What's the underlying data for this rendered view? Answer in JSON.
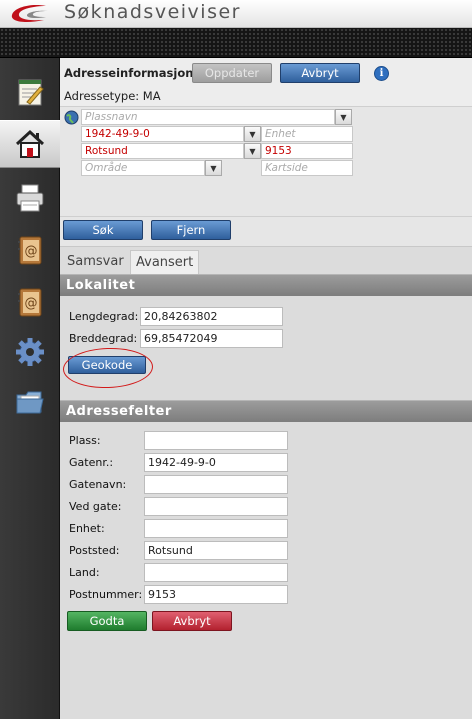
{
  "app": {
    "title": "Søknadsveiviser"
  },
  "sidebar": {
    "items": [
      {
        "icon": "notepad-icon"
      },
      {
        "icon": "house-icon",
        "active": true
      },
      {
        "icon": "printer-icon"
      },
      {
        "icon": "address-book-icon"
      },
      {
        "icon": "address-book-icon"
      },
      {
        "icon": "gear-icon"
      },
      {
        "icon": "folder-icon"
      }
    ]
  },
  "header": {
    "label": "Adresseinformasjon:",
    "update_label": "Oppdater",
    "cancel_label": "Avbryt",
    "address_type": "Adressetype: MA"
  },
  "address": {
    "plassnavn_placeholder": "Plassnavn",
    "gatenr_value": "1942-49-9-0",
    "enhet_placeholder": "Enhet",
    "poststed_value": "Rotsund",
    "postnummer_value": "9153",
    "omrade_placeholder": "Område",
    "kartside_placeholder": "Kartside"
  },
  "search": {
    "search_label": "Søk",
    "remove_label": "Fjern"
  },
  "tabs": [
    {
      "label": "Samsvar"
    },
    {
      "label": "Avansert",
      "active": true
    }
  ],
  "lokalitet": {
    "title": "Lokalitet",
    "lengdegrad_label": "Lengdegrad:",
    "lengdegrad_value": "20,84263802",
    "breddegrad_label": "Breddegrad:",
    "breddegrad_value": "69,85472049",
    "geokode_label": "Geokode"
  },
  "adressefelter": {
    "title": "Adressefelter",
    "fields": [
      {
        "label": "Plass:",
        "value": ""
      },
      {
        "label": "Gatenr.:",
        "value": "1942-49-9-0"
      },
      {
        "label": "Gatenavn:",
        "value": ""
      },
      {
        "label": "Ved gate:",
        "value": ""
      },
      {
        "label": "Enhet:",
        "value": ""
      },
      {
        "label": "Poststed:",
        "value": "Rotsund"
      },
      {
        "label": "Land:",
        "value": ""
      },
      {
        "label": "Postnummer:",
        "value": "9153"
      }
    ],
    "accept_label": "Godta",
    "cancel_label": "Avbryt"
  },
  "colors": {
    "accent_blue": "#2f5f9c",
    "accept_green": "#1f7c2e",
    "cancel_red": "#b3212f",
    "annotation_red": "#d21a1a",
    "input_red_text": "#c40000"
  }
}
